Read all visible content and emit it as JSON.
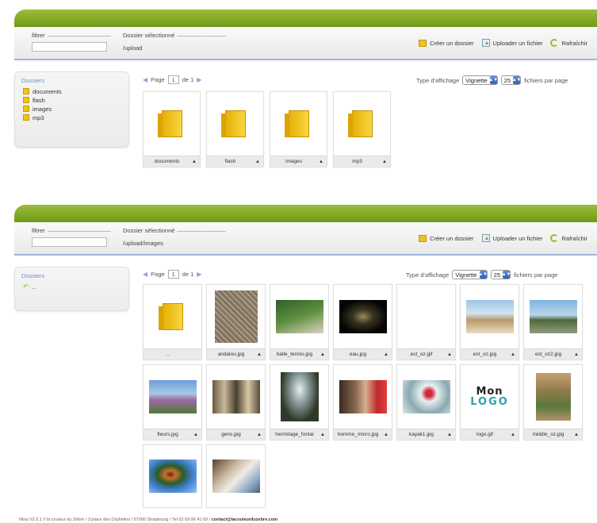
{
  "panel1": {
    "filter_label": "filtrer",
    "folder_label": "Dossier sélectionné",
    "folder_path": "/upload",
    "actions": {
      "create": "Créer un dossier",
      "upload": "Uploader un fichier",
      "refresh": "Rafraîchir"
    },
    "sidebar": {
      "title": "Dossiers",
      "items": [
        "documents",
        "flash",
        "images",
        "mp3"
      ]
    },
    "pager": {
      "page_label": "Page",
      "page": "1",
      "of_label": "de 1"
    },
    "display": {
      "type_label": "Type d'affichage",
      "mode": "Vignette",
      "per_page": "25",
      "per_page_label": "fichiers par page"
    },
    "files": [
      "documents",
      "flash",
      "images",
      "mp3"
    ]
  },
  "panel2": {
    "filter_label": "filtrer",
    "folder_label": "Dossier sélectionné",
    "folder_path": "/upload/images",
    "actions": {
      "create": "Créer un dossier",
      "upload": "Uploader un fichier",
      "refresh": "Rafraîchir"
    },
    "sidebar": {
      "title": "Dossiers",
      "items": [
        ".."
      ]
    },
    "pager": {
      "page_label": "Page",
      "page": "1",
      "of_label": "de 1"
    },
    "display": {
      "type_label": "Type d'affichage",
      "mode": "Vignette",
      "per_page": "25",
      "per_page_label": "fichiers par page"
    },
    "files": [
      "..",
      "andalou.jpg",
      "balle_tennis.jpg",
      "eau.jpg",
      "est_oz.gif",
      "est_oz.jpg",
      "est_oz2.jpg",
      "fleurs.jpg",
      "gens.jpg",
      "hermitage_fontai",
      "homme_micro.jpg",
      "kayak1.jpg",
      "logo.gif",
      "middle_oz.jpg",
      "",
      ""
    ]
  },
  "logo_text": {
    "line1": "Mon",
    "line2": "LOGO"
  },
  "footer": {
    "text": "Nina V2.0.1 // la couleur du Zèbre / 3 place des Orphelins / 67000 Strasbourg / Tel 03 69 96 41 69 / ",
    "contact": "contact@lacouleurduzebre.com"
  },
  "colors": {
    "green": "#7da222",
    "accent_blue": "#6f8fc0",
    "folder_yellow": "#f2c413"
  }
}
